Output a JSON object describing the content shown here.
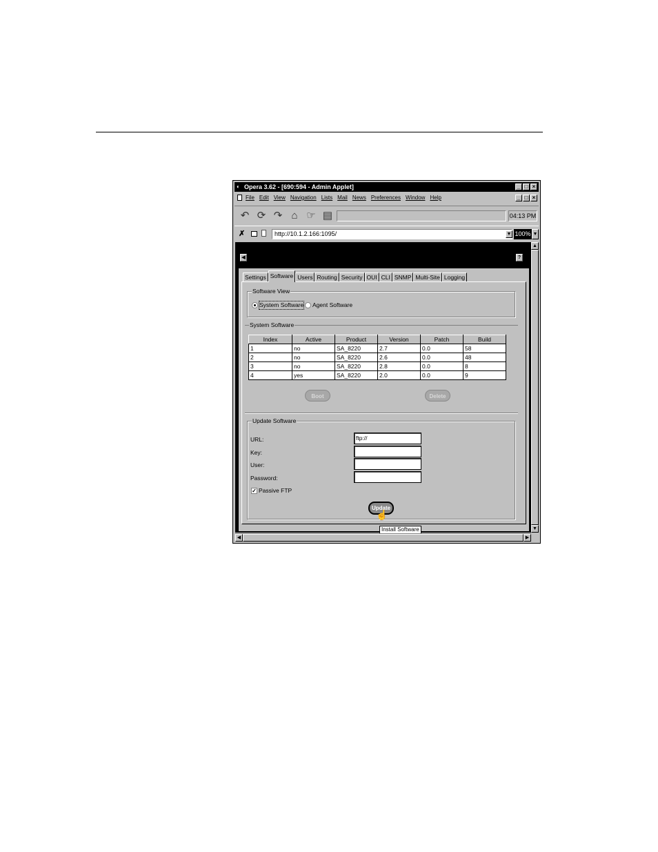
{
  "window": {
    "title": "Opera 3.62 - [690:594 - Admin Applet]",
    "controls": [
      "_",
      "□",
      "×"
    ]
  },
  "menu": {
    "items": [
      "File",
      "Edit",
      "View",
      "Navigation",
      "Lists",
      "Mail",
      "News",
      "Preferences",
      "Window",
      "Help"
    ]
  },
  "toolbar": {
    "clock": "04:13 PM"
  },
  "address": {
    "url": "http://10.1.2.166:1095/",
    "zoom": "100%"
  },
  "tabs": [
    "Settings",
    "Software",
    "Users",
    "Routing",
    "Security",
    "OUI",
    "CLI",
    "SNMP",
    "Multi-Site",
    "Logging"
  ],
  "active_tab": "Software",
  "software_view": {
    "label": "Software View",
    "options": [
      "System Software",
      "Agent Software"
    ],
    "selected": "System Software"
  },
  "system_software": {
    "label": "System Software",
    "columns": [
      "Index",
      "Active",
      "Product",
      "Version",
      "Patch",
      "Build"
    ],
    "rows": [
      [
        "1",
        "no",
        "SA_8220",
        "2.7",
        "0.0",
        "58"
      ],
      [
        "2",
        "no",
        "SA_8220",
        "2.6",
        "0.0",
        "48"
      ],
      [
        "3",
        "no",
        "SA_8220",
        "2.8",
        "0.0",
        "8"
      ],
      [
        "4",
        "yes",
        "SA_8220",
        "2.0",
        "0.0",
        "9"
      ]
    ],
    "boot_label": "Boot",
    "delete_label": "Delete"
  },
  "update_software": {
    "label": "Update Software",
    "url_label": "URL:",
    "url_value": "ftp://",
    "key_label": "Key:",
    "user_label": "User:",
    "password_label": "Password:",
    "passive_label": "Passive FTP",
    "passive_checked": true,
    "update_label": "Update",
    "tooltip": "Install Software"
  }
}
